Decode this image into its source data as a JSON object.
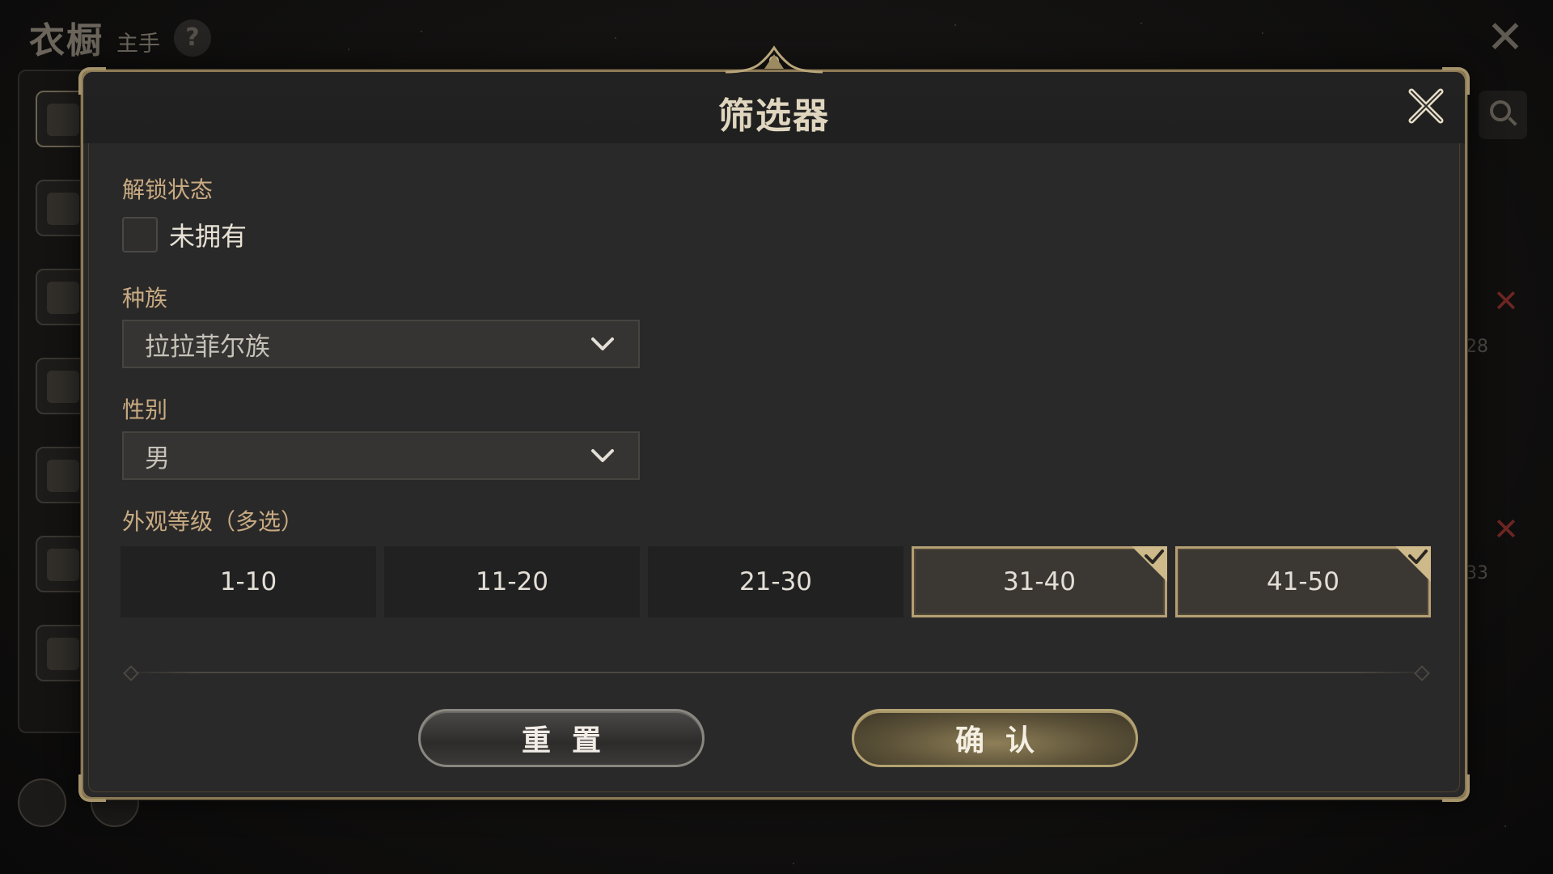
{
  "background": {
    "title": "衣橱",
    "subtitle": "主手",
    "help_label": "?",
    "side_numbers": [
      "28",
      "33"
    ]
  },
  "modal": {
    "title": "筛选器",
    "unlock": {
      "label": "解锁状态",
      "checkbox_label": "未拥有",
      "checked": false
    },
    "race": {
      "label": "种族",
      "value": "拉拉菲尔族"
    },
    "gender": {
      "label": "性别",
      "value": "男"
    },
    "grade": {
      "label": "外观等级（多选）",
      "options": [
        {
          "label": "1-10",
          "selected": false
        },
        {
          "label": "11-20",
          "selected": false
        },
        {
          "label": "21-30",
          "selected": false
        },
        {
          "label": "31-40",
          "selected": true
        },
        {
          "label": "41-50",
          "selected": true
        }
      ]
    },
    "buttons": {
      "reset": "重置",
      "confirm": "确认"
    }
  },
  "colors": {
    "accent_gold": "#b49f74",
    "panel_bg": "#2a2929",
    "label_color": "#c8ab82",
    "warning_red": "#6d2622"
  },
  "icons": {
    "close": "close-icon",
    "chevron": "chevron-down-icon",
    "check": "check-icon",
    "search": "search-icon"
  }
}
